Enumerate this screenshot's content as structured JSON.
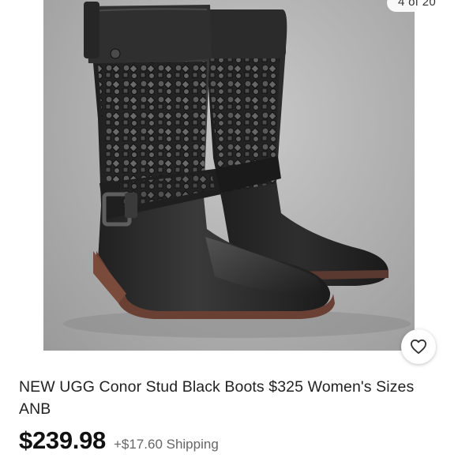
{
  "image": {
    "counter_text": "4 of 20",
    "icon": "boot-photo"
  },
  "listing": {
    "title_main": "NEW UGG Conor Stud Black Boots $325 Women's Sizes",
    "title_tag": "ANB",
    "price": "$239.98",
    "shipping": "+$17.60 Shipping"
  },
  "actions": {
    "like_icon": "heart-icon"
  },
  "colors": {
    "boot_leather": "#2a2a2a",
    "background_gray": "#b3b3b3",
    "text_primary": "#222222",
    "text_secondary": "#666666"
  }
}
